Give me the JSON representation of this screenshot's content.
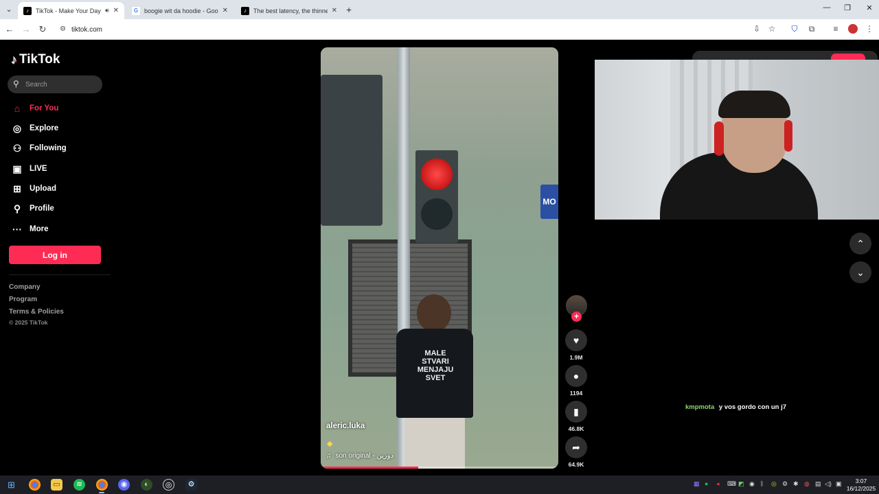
{
  "browser": {
    "tabs": [
      {
        "title": "TikTok - Make Your Day",
        "active": true,
        "audio": true
      },
      {
        "title": "boogie wit da hoodie - Google",
        "active": false,
        "audio": false
      },
      {
        "title": "The best latency, the thinnest",
        "active": false,
        "audio": false
      }
    ],
    "url": "tiktok.com",
    "icons": [
      "back-icon",
      "forward-icon",
      "reload-icon",
      "site-info-icon",
      "install-icon",
      "star-icon",
      "extension-icon",
      "media-icon",
      "profile-icon",
      "kebab-menu-icon"
    ]
  },
  "sidebar": {
    "brand": "TikTok",
    "search_placeholder": "Search",
    "nav": [
      {
        "label": "For You",
        "icon": "home-icon",
        "active": true
      },
      {
        "label": "Explore",
        "icon": "compass-icon",
        "active": false
      },
      {
        "label": "Following",
        "icon": "following-icon",
        "active": false
      },
      {
        "label": "LIVE",
        "icon": "live-icon",
        "active": false
      },
      {
        "label": "Upload",
        "icon": "upload-icon",
        "active": false
      },
      {
        "label": "Profile",
        "icon": "profile-icon",
        "active": false
      },
      {
        "label": "More",
        "icon": "more-icon",
        "active": false
      }
    ],
    "login_label": "Log in",
    "footer": [
      "Company",
      "Program",
      "Terms & Policies"
    ],
    "copyright": "© 2025 TikTok"
  },
  "video": {
    "author": "aleric.luka",
    "music": "son original - دورين",
    "sign_text": "MO",
    "shirt_text": "MALE STVARI MENJAJU SVET",
    "progress": 0.41
  },
  "actions": {
    "likes": "1.9M",
    "comments": "1194",
    "saves": "46.8K",
    "shares": "64.9K"
  },
  "chat": {
    "user": "kmpmota",
    "message": "y vos gordo con un j7"
  },
  "taskbar": {
    "time": "3:07",
    "date": "16/12/2025"
  },
  "colors": {
    "accent": "#fe2c55",
    "background": "#000000",
    "chat_user": "#8edb6a"
  }
}
